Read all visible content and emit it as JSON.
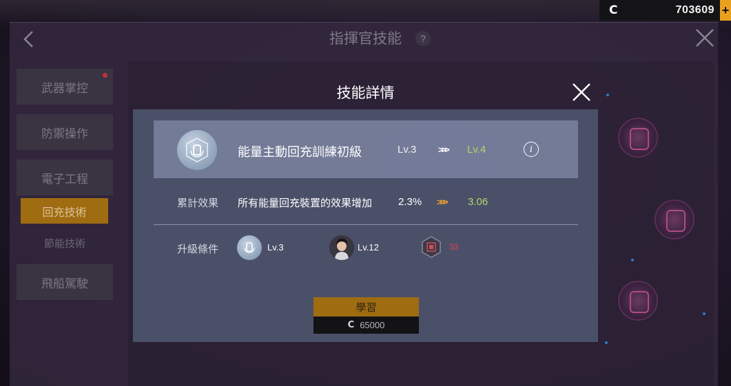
{
  "currency": {
    "symbol": "C",
    "amount": "703609",
    "add_label": "+"
  },
  "header": {
    "title": "指揮官技能",
    "help_label": "?"
  },
  "sidebar": {
    "tabs": [
      {
        "label": "武器掌控"
      },
      {
        "label": "防禦操作"
      },
      {
        "label": "電子工程"
      },
      {
        "label": "回充技術"
      },
      {
        "label": "節能技術"
      },
      {
        "label": "飛船駕駛"
      }
    ],
    "active": "回充技術"
  },
  "modal": {
    "title": "技能詳情",
    "skill": {
      "name": "能量主動回充訓練初級",
      "level_current": "Lv.3",
      "level_next": "Lv.4",
      "arrows": ">>>",
      "info_label": "i"
    },
    "effect": {
      "label": "累計效果",
      "text": "所有能量回充裝置的效果增加",
      "current": "2.3%",
      "next": "3.06",
      "arrows": ">>>"
    },
    "requirements": {
      "label": "升級條件",
      "skill_level": "Lv.3",
      "commander_level": "Lv.12",
      "item_count": "33"
    },
    "learn_button": {
      "label": "學習",
      "cost_symbol": "C",
      "cost": "65000"
    }
  },
  "colors": {
    "accent_gold": "#a06c12",
    "level_green": "#b3d86a",
    "warning_red": "#e0424a",
    "arrow_gold": "#f0a52a"
  }
}
